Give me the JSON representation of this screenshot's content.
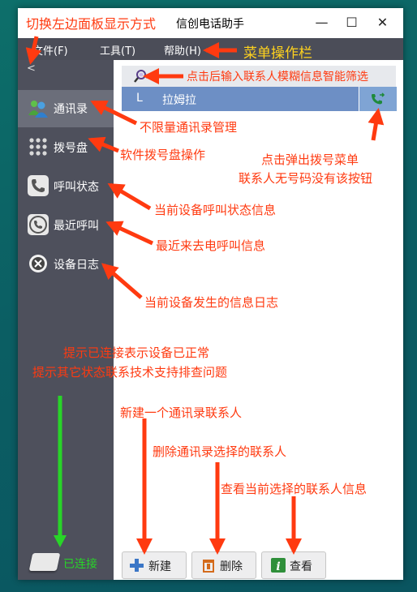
{
  "window": {
    "title": "信创电话助手",
    "minimize": "—",
    "maximize": "☐",
    "close": "✕"
  },
  "menu": [
    "文件(F)",
    "工具(T)",
    "帮助(H)"
  ],
  "sidebar": {
    "collapse": "<",
    "items": [
      {
        "label": "通讯录"
      },
      {
        "label": "拨号盘"
      },
      {
        "label": "呼叫状态"
      },
      {
        "label": "最近呼叫"
      },
      {
        "label": "设备日志"
      }
    ],
    "status": "已连接"
  },
  "contacts": [
    {
      "letter": "L",
      "name": "拉姆拉"
    }
  ],
  "buttons": {
    "new": "新建",
    "delete": "删除",
    "view": "查看"
  },
  "annotations": {
    "toggle_panel": "切换左边面板显示方式",
    "menu_bar": "菜单操作栏",
    "filter": "点击后输入联系人模糊信息智能筛选",
    "contacts": "不限量通讯录管理",
    "dialpad": "软件拨号盘操作",
    "dial_menu": "点击弹出拨号菜单",
    "dial_menu_2": "联系人无号码没有该按钮",
    "call_status": "当前设备呼叫状态信息",
    "recent": "最近来去电呼叫信息",
    "log": "当前设备发生的信息日志",
    "connected_1": "提示已连接表示设备已正常",
    "connected_2": "提示其它状态联系技术支持排查问题",
    "new": "新建一个通讯录联系人",
    "delete": "删除通讯录选择的联系人",
    "view": "查看当前选择的联系人信息"
  },
  "colors": {
    "accent": "#6d8fc5",
    "sidebar": "#4e505c",
    "annotation": "#ff3a10",
    "annotation_yellow": "#ffd21e",
    "connected": "#28d428"
  }
}
